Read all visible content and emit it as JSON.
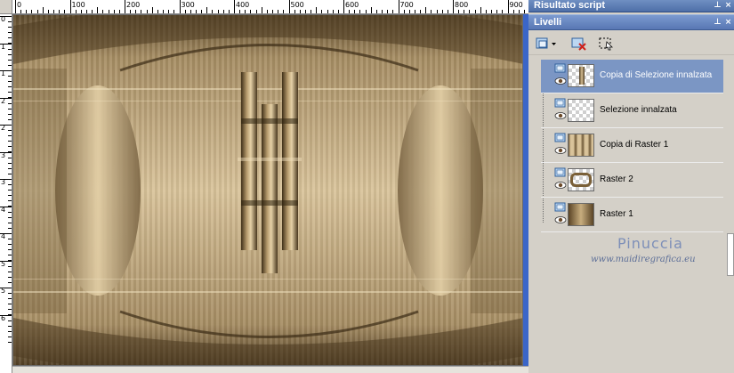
{
  "script_panel": {
    "title": "Risultato script"
  },
  "layers_panel": {
    "title": "Livelli",
    "toolbar": [
      {
        "icon": "new-layer-icon"
      },
      {
        "icon": "delete-layer-icon"
      },
      {
        "icon": "selection-tool-icon"
      }
    ],
    "layers": [
      {
        "name": "Copia di Selezione innalzata",
        "selected": true,
        "thumb": "checker-bar"
      },
      {
        "name": "Selezione innalzata",
        "selected": false,
        "thumb": "checker"
      },
      {
        "name": "Copia di Raster 1",
        "selected": false,
        "thumb": "checker-bronze"
      },
      {
        "name": "Raster 2",
        "selected": false,
        "thumb": "checker-frame"
      },
      {
        "name": "Raster 1",
        "selected": false,
        "thumb": "bronze"
      }
    ]
  },
  "watermark": {
    "name": "Pinuccia",
    "url": "www.maidiregrafica.eu"
  },
  "ruler": {
    "h_labels": [
      "0",
      "100",
      "200",
      "300",
      "400",
      "500",
      "600",
      "700",
      "800",
      "900"
    ],
    "v_labels": [
      "0",
      "1",
      "1",
      "2",
      "2",
      "3",
      "3",
      "4",
      "4",
      "5",
      "5",
      "6"
    ]
  },
  "colors": {
    "accent_title": "#5877b3",
    "selected_row": "#7b96c4",
    "canvas_bronze": "#b8a27a",
    "canvas_dark": "#6e5836"
  }
}
